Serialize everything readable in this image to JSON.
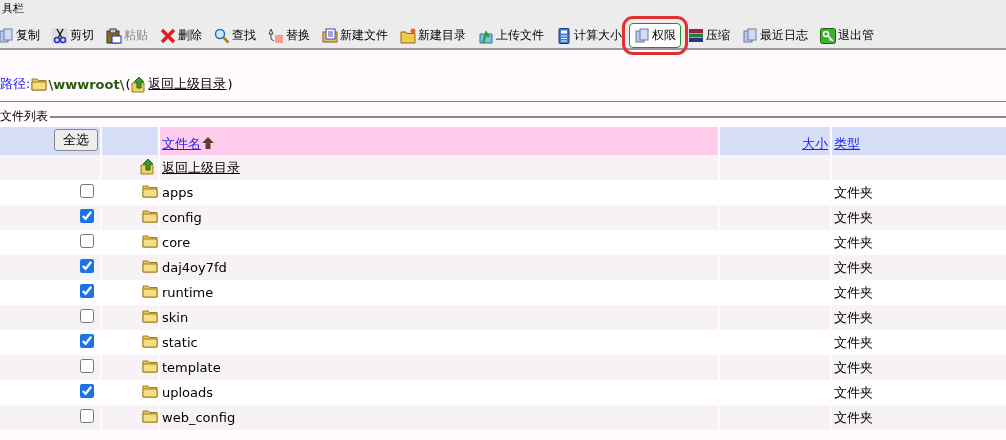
{
  "toolbar": {
    "legend": "具栏",
    "buttons": [
      {
        "label": "复制",
        "disabled": false,
        "selected": false,
        "highlighted": false
      },
      {
        "label": "剪切",
        "disabled": false,
        "selected": false,
        "highlighted": false
      },
      {
        "label": "粘贴",
        "disabled": true,
        "selected": false,
        "highlighted": false
      },
      {
        "label": "删除",
        "disabled": false,
        "selected": false,
        "highlighted": false
      },
      {
        "label": "查找",
        "disabled": false,
        "selected": false,
        "highlighted": false
      },
      {
        "label": "替换",
        "disabled": false,
        "selected": false,
        "highlighted": false
      },
      {
        "label": "新建文件",
        "disabled": false,
        "selected": false,
        "highlighted": false
      },
      {
        "label": "新建目录",
        "disabled": false,
        "selected": false,
        "highlighted": false
      },
      {
        "label": "上传文件",
        "disabled": false,
        "selected": false,
        "highlighted": false
      },
      {
        "label": "计算大小",
        "disabled": false,
        "selected": false,
        "highlighted": false
      },
      {
        "label": "权限",
        "disabled": false,
        "selected": true,
        "highlighted": true
      },
      {
        "label": "压缩",
        "disabled": false,
        "selected": false,
        "highlighted": false
      },
      {
        "label": "最近日志",
        "disabled": false,
        "selected": false,
        "highlighted": false
      },
      {
        "label": "退出管",
        "disabled": false,
        "selected": false,
        "highlighted": false
      }
    ]
  },
  "path": {
    "label": "路径:",
    "value": "\\wwwroot\\",
    "open_paren": "(",
    "up_link": "返回上级目录",
    "close_paren": ")"
  },
  "file_list": {
    "legend": "文件列表",
    "select_all": "全选",
    "columns": [
      {
        "label": "文件名",
        "sorted": true
      },
      {
        "label": "大小",
        "sorted": false
      },
      {
        "label": "类型",
        "sorted": false
      }
    ],
    "parent_link": "返回上级目录",
    "rows": [
      {
        "name": "apps",
        "type": "文件夹",
        "checked": false
      },
      {
        "name": "config",
        "type": "文件夹",
        "checked": true
      },
      {
        "name": "core",
        "type": "文件夹",
        "checked": false
      },
      {
        "name": "daj4oy7fd",
        "type": "文件夹",
        "checked": true
      },
      {
        "name": "runtime",
        "type": "文件夹",
        "checked": true
      },
      {
        "name": "skin",
        "type": "文件夹",
        "checked": false
      },
      {
        "name": "static",
        "type": "文件夹",
        "checked": true
      },
      {
        "name": "template",
        "type": "文件夹",
        "checked": false
      },
      {
        "name": "uploads",
        "type": "文件夹",
        "checked": true
      },
      {
        "name": "web_config",
        "type": "文件夹",
        "checked": false
      }
    ]
  }
}
